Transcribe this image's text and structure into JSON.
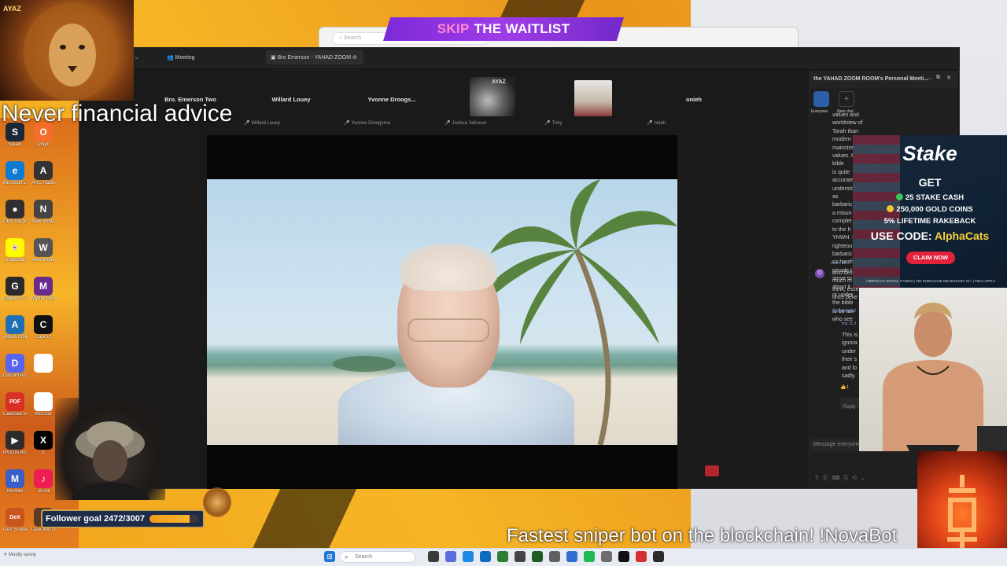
{
  "banner": {
    "skip": "SKIP",
    "rest": "THE WAITLIST"
  },
  "background_browser": {
    "search_text": "Search"
  },
  "zoom": {
    "tabs": [
      "Meeting",
      "Bro Emerson - YAHAD ZOOM"
    ],
    "participants": [
      {
        "name": "Bro. Emerson Two",
        "sub": "Bro. Emerson Two"
      },
      {
        "name": "Willard Louey",
        "sub": "Willard Louey"
      },
      {
        "name": "Yvonne  Droogs...",
        "sub": "Yvonne Droogsma"
      },
      {
        "name": "",
        "sub": "Joshua Yahsuun"
      },
      {
        "name": "",
        "sub": "Trely"
      },
      {
        "name": "onieh",
        "sub": "onieh"
      }
    ],
    "thumb_lion_text": "AYAZ"
  },
  "chat": {
    "title": "the YAHAD ZOOM ROOM's Personal Meeti...",
    "tabs": [
      "Everyone",
      "New chat"
    ],
    "message1": [
      "values and worldview of Torah than",
      "modern mainstream values. the bible",
      "is quite accurately understood as",
      "barbaric",
      "a misun",
      "complet",
      "to the h",
      "YHWH. t",
      "righteou",
      "barbaric",
      "so harsh",
      "people t",
      "serve to",
      "about it",
      "or under",
      "the bible",
      "to be tak",
      "who see"
    ],
    "sender2": "onieh 11:2",
    "message2": [
      "also beli",
      "much m",
      "think, esse",
      "once belie"
    ],
    "collapse": "Collapse al",
    "sender3": "You 11:3",
    "message3": [
      "This is",
      "ignora",
      "under",
      "their s",
      "and lo",
      "sadly."
    ],
    "reply": "Reply",
    "input_placeholder": "Message everyone"
  },
  "ad": {
    "brand": "Stake",
    "get": "GET",
    "line1": "25 STAKE CASH",
    "line2": "250,000 GOLD COINS",
    "line3": "5% LIFETIME RAKEBACK",
    "code_prefix": "USE CODE: ",
    "code": "AlphaCats",
    "cta": "CLAIM NOW",
    "fine": "AMERICA'S SOCIAL CASINO | NO PURCHASE NECESSARY     21+ | T&Cs APPLY"
  },
  "overlay": {
    "disclaimer": "Never financial advice",
    "lion_text": "AYAZ",
    "follower_goal": "Follower goal 2472/3007",
    "follower_progress": 0.822,
    "ticker": "Fastest sniper bot on the blockchain! !NovaBot"
  },
  "desktop_icons": [
    {
      "label": "Steam",
      "color": "#1b2838",
      "glyph": "S"
    },
    {
      "label": "Origin",
      "color": "#f56c2d",
      "glyph": "O"
    },
    {
      "label": "Microsoft Edge",
      "color": "#0c7bd1",
      "glyph": "e"
    },
    {
      "label": "ARC Raiders",
      "color": "#333333",
      "glyph": "A"
    },
    {
      "label": "OBS Studio",
      "color": "#302e31",
      "glyph": "●"
    },
    {
      "label": "New World",
      "color": "#444444",
      "glyph": "N"
    },
    {
      "label": "Snapchat",
      "color": "#fffc00",
      "glyph": "👻"
    },
    {
      "label": "New World",
      "color": "#555555",
      "glyph": "W"
    },
    {
      "label": "Logitech G HUB",
      "color": "#2a2a2a",
      "glyph": "G"
    },
    {
      "label": "Mythic Heroes",
      "color": "#6b2b8a",
      "glyph": "M"
    },
    {
      "label": "Albion Online",
      "color": "#1f6fb5",
      "glyph": "A"
    },
    {
      "label": "CapCut",
      "color": "#111111",
      "glyph": "C"
    },
    {
      "label": "Discord Archive",
      "color": "#5865f2",
      "glyph": "D"
    },
    {
      "label": "",
      "color": "#ffffff",
      "glyph": ""
    },
    {
      "label": "Calendar Book",
      "color": "#d93025",
      "glyph": "PDF"
    },
    {
      "label": "WeChat",
      "color": "#ffffff",
      "glyph": ""
    },
    {
      "label": "NVIDIA Broadcast",
      "color": "#2c2c2c",
      "glyph": "▶"
    },
    {
      "label": "X",
      "color": "#000000",
      "glyph": "X"
    },
    {
      "label": "McAfee",
      "color": "#3b5ec6",
      "glyph": "M"
    },
    {
      "label": "TikTok",
      "color": "#ee1d52",
      "glyph": "♪"
    },
    {
      "label": "DeX Screener",
      "color": "#c9541d",
      "glyph": "DeX"
    },
    {
      "label": "Dark and Darker",
      "color": "#5a3b2a",
      "glyph": ""
    }
  ],
  "taskbar": {
    "search": "Search",
    "weather": "Mostly sunny"
  },
  "colors": {
    "banner_purple": "#8a2be2",
    "stake_red": "#e2213b",
    "zoom_bg": "#1a1a1a",
    "wallpaper_orange": "#f2a51c"
  }
}
